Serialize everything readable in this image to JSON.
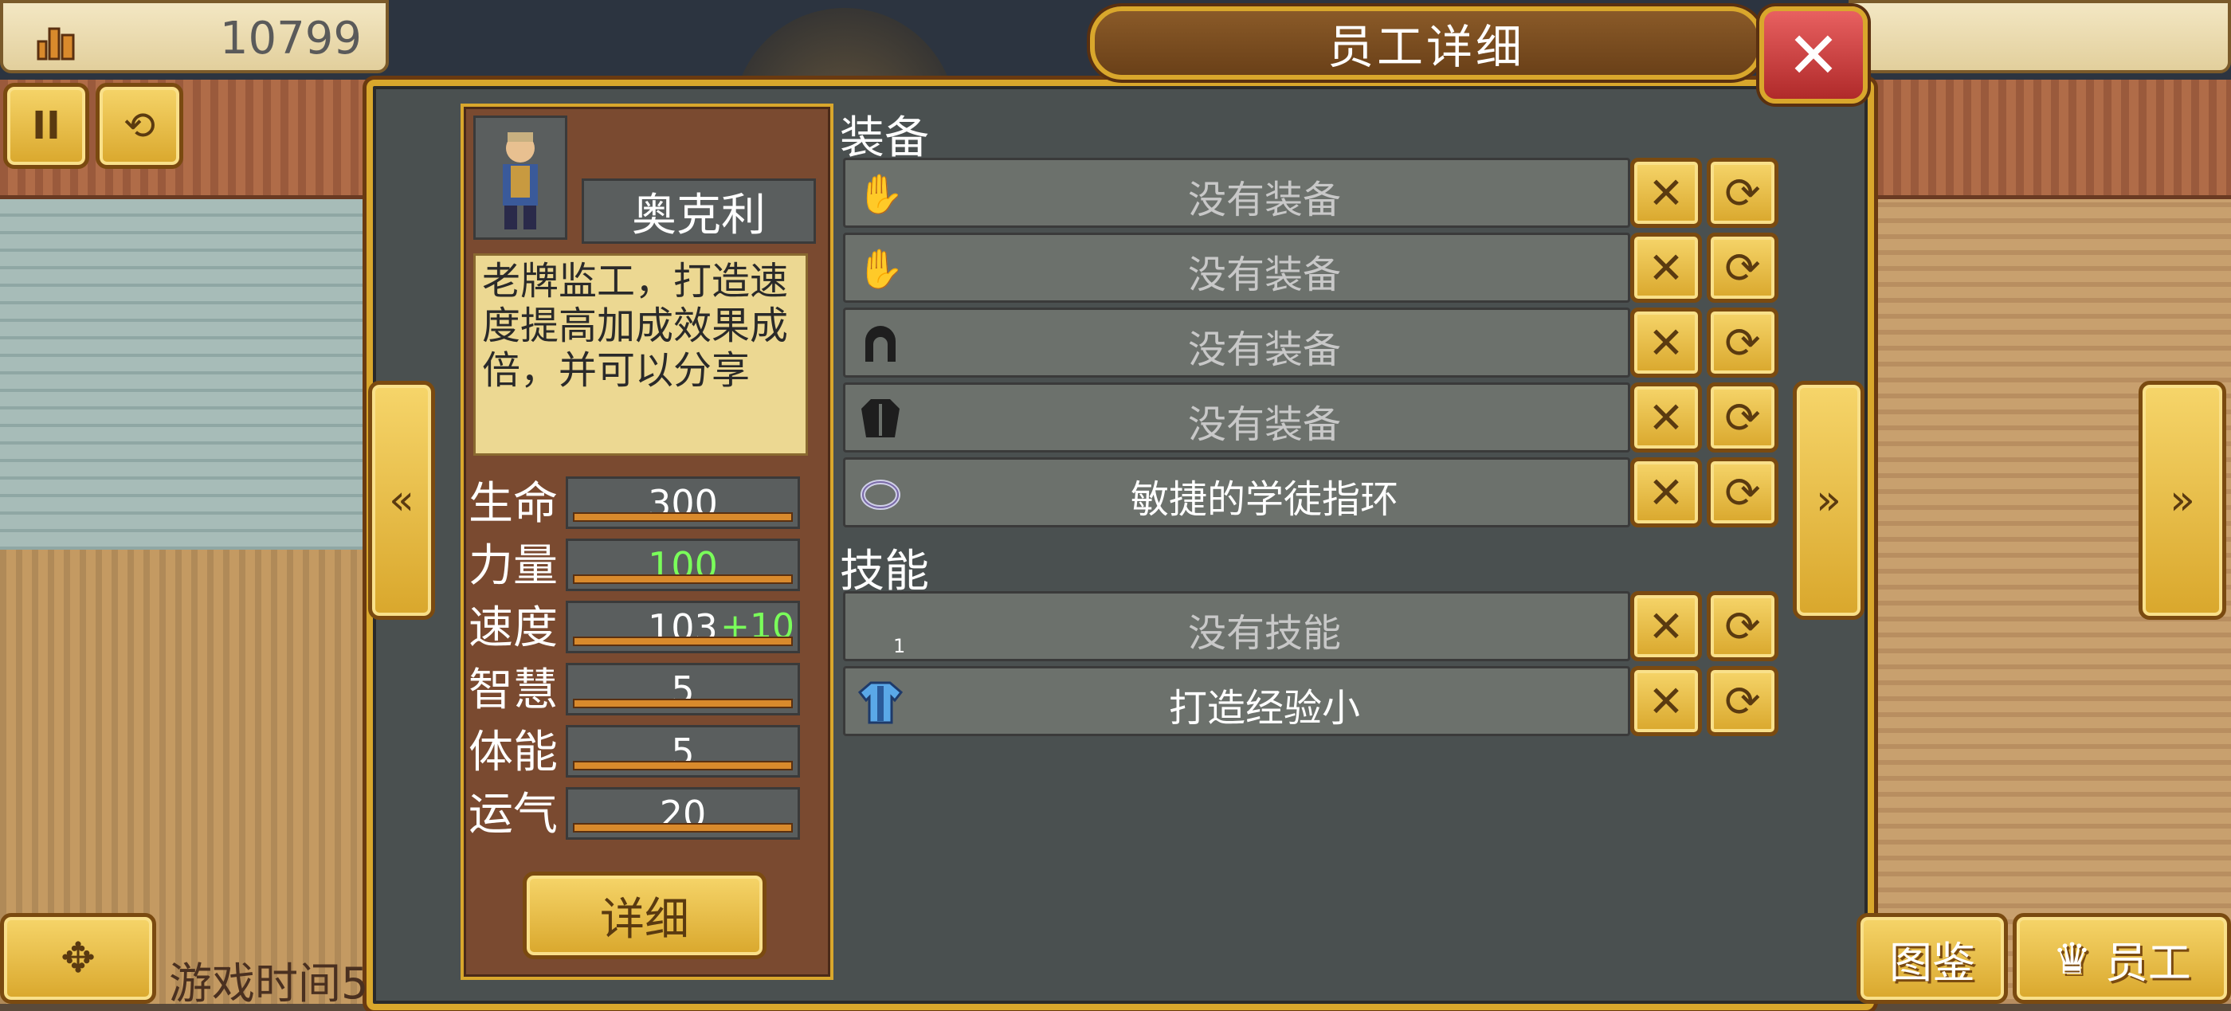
{
  "topbar": {
    "money": "10799"
  },
  "controls": {
    "pause_label": "II",
    "speed_label": "»"
  },
  "dialog": {
    "title": "员工详细",
    "close_label": "✕",
    "character": {
      "name": "奥克利",
      "description": "老牌监工，打造速度提高加成效果成倍，并可以分享",
      "stats": [
        {
          "label": "生命",
          "value": "300",
          "bonus": ""
        },
        {
          "label": "力量",
          "value": "100",
          "bonus": ""
        },
        {
          "label": "速度",
          "value": "103",
          "bonus": "+10"
        },
        {
          "label": "智慧",
          "value": "5",
          "bonus": ""
        },
        {
          "label": "体能",
          "value": "5",
          "bonus": ""
        },
        {
          "label": "运气",
          "value": "20",
          "bonus": ""
        }
      ],
      "detail_button": "详细"
    },
    "equipment": {
      "title": "装备",
      "slots": [
        {
          "icon": "hand-icon",
          "text": "没有装备"
        },
        {
          "icon": "glove-icon",
          "text": "没有装备"
        },
        {
          "icon": "helmet-icon",
          "text": "没有装备"
        },
        {
          "icon": "armor-icon",
          "text": "没有装备"
        },
        {
          "icon": "ring-icon",
          "text": "敏捷的学徒指环"
        }
      ]
    },
    "skills": {
      "title": "技能",
      "slots": [
        {
          "icon": "",
          "text": "没有技能",
          "num": "1"
        },
        {
          "icon": "shirt-icon",
          "text": "打造经验小",
          "num": ""
        }
      ]
    }
  },
  "bottom": {
    "gametime": "游戏时间5",
    "tujian": "图鉴",
    "staff": "员工"
  },
  "colors": {
    "gold": "#d9a72c",
    "panel": "#4a5050",
    "card": "#7a4a30",
    "bonus_green": "#7aff5a",
    "close_red": "#c83a3a"
  }
}
